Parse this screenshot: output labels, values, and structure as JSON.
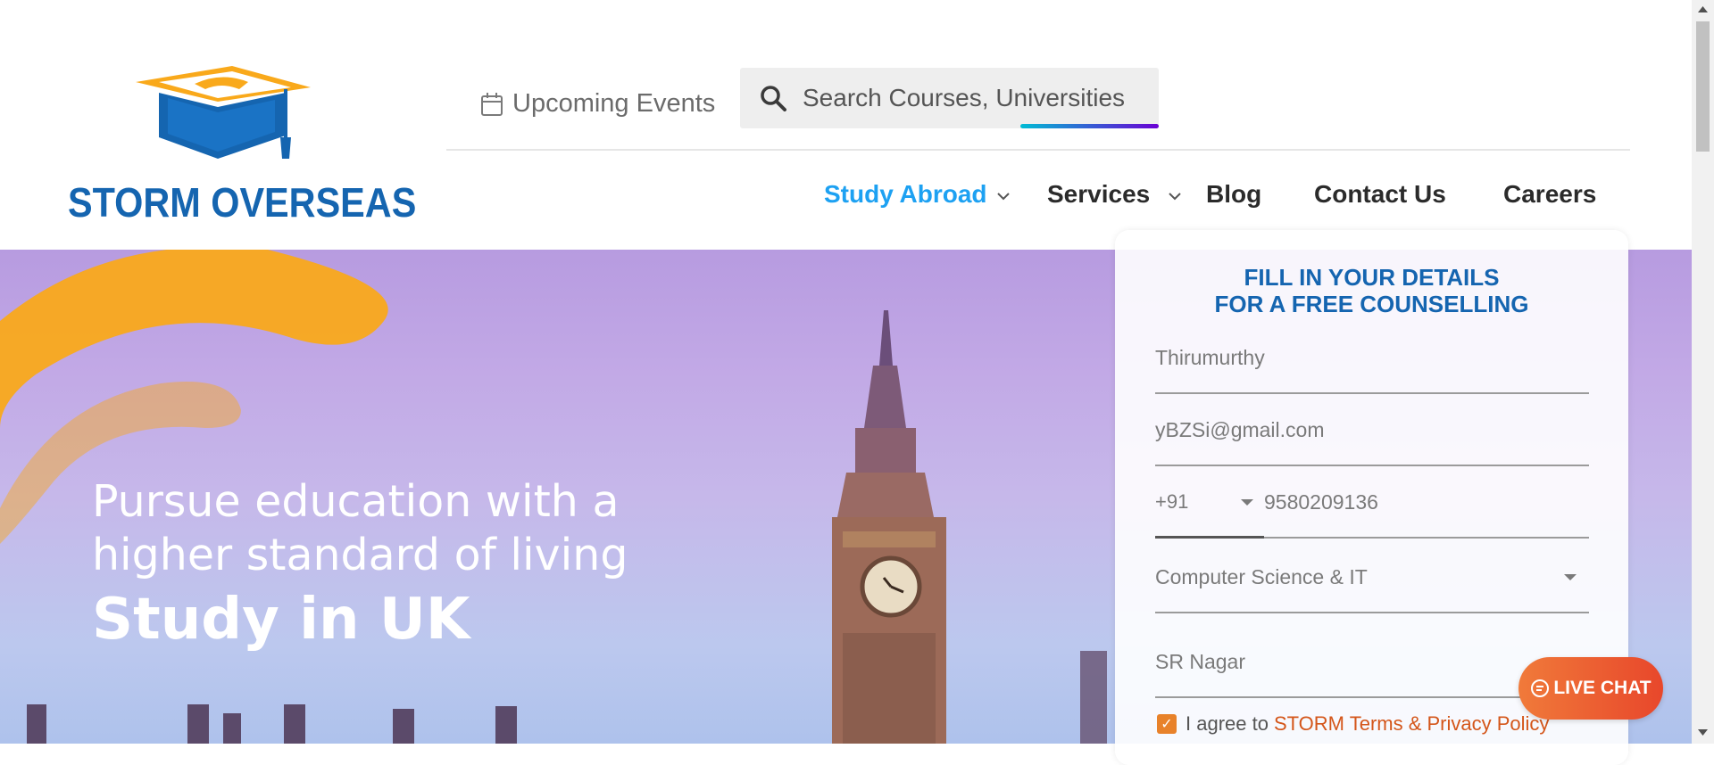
{
  "brand": {
    "name": "STORM OVERSEAS",
    "colors": {
      "primary": "#1565b0",
      "accent": "#f9a91b",
      "active_nav": "#1da1f2"
    }
  },
  "header": {
    "events_label": "Upcoming Events",
    "search_placeholder": "Search Courses, Universities"
  },
  "nav": {
    "items": [
      {
        "label": "Study Abroad",
        "has_dropdown": true,
        "active": true
      },
      {
        "label": "Services",
        "has_dropdown": true,
        "active": false
      },
      {
        "label": "Blog",
        "has_dropdown": false,
        "active": false
      },
      {
        "label": "Contact Us",
        "has_dropdown": false,
        "active": false
      },
      {
        "label": "Careers",
        "has_dropdown": false,
        "active": false
      }
    ]
  },
  "hero": {
    "subtitle_line1": "Pursue education with a",
    "subtitle_line2": "higher standard of living",
    "title": "Study in UK"
  },
  "form": {
    "title_line1": "FILL IN YOUR DETAILS",
    "title_line2": "FOR A FREE COUNSELLING",
    "name_value": "Thirumurthy",
    "email_value": "yBZSi@gmail.com",
    "phone_code": "+91",
    "phone_value": "9580209136",
    "course_value": "Computer Science & IT",
    "location_value": "SR Nagar",
    "agree_text": "I agree to",
    "agree_link": "STORM Terms & Privacy Policy",
    "agree_checked": true
  },
  "live_chat": {
    "label": "LIVE CHAT"
  }
}
